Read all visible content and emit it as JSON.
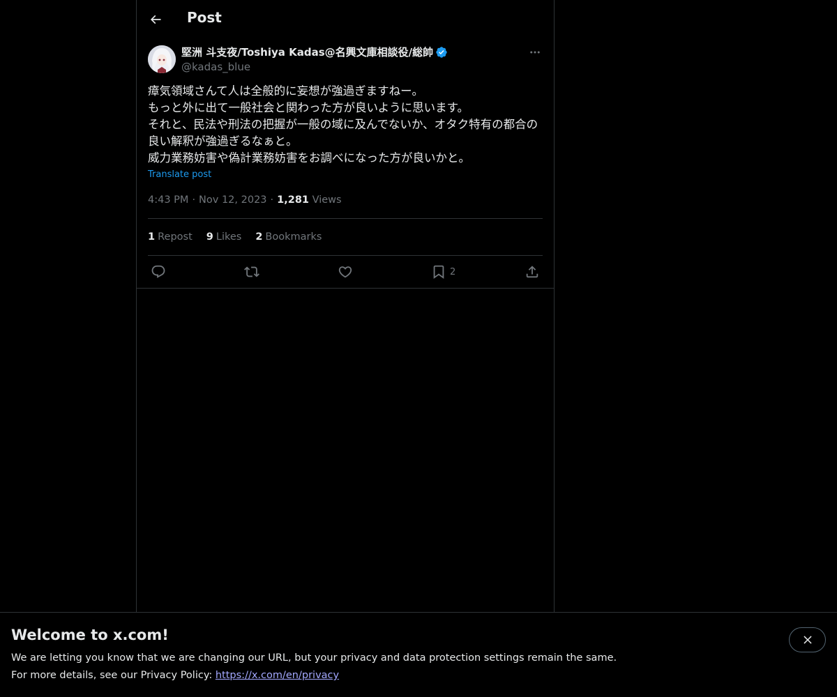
{
  "header": {
    "title": "Post",
    "back_icon": "arrow-left-icon"
  },
  "post": {
    "author": {
      "display_name": "堅洲 斗支夜/Toshiya Kadas@名興文庫相談役/総帥",
      "handle": "@kadas_blue",
      "verified": true,
      "verified_color": "#1d9bf0"
    },
    "text": "瘴気領域さんて人は全般的に妄想が強過ぎますねー。\nもっと外に出て一般社会と関わった方が良いように思います。\nそれと、民法や刑法の把握が一般の域に及んでないか、オタク特有の都合の良い解釈が強過ぎるなぁと。\n威力業務妨害や偽計業務妨害をお調べになった方が良いかと。",
    "translate_label": "Translate post",
    "time": "4:43 PM",
    "date": "Nov 12, 2023",
    "separator": "·",
    "views_count": "1,281",
    "views_label": "Views",
    "stats": {
      "reposts_count": "1",
      "reposts_label": "Repost",
      "likes_count": "9",
      "likes_label": "Likes",
      "bookmarks_count": "2",
      "bookmarks_label": "Bookmarks"
    },
    "actions": {
      "reply_icon": "reply-icon",
      "repost_icon": "repost-icon",
      "like_icon": "heart-icon",
      "bookmark_icon": "bookmark-icon",
      "bookmark_count": "2",
      "share_icon": "share-icon"
    }
  },
  "banner": {
    "title": "Welcome to x.com!",
    "line1": "We are letting you know that we are changing our URL, but your privacy and data protection settings remain the same.",
    "line2_prefix": "For more details, see our Privacy Policy: ",
    "link": "https://x.com/en/privacy",
    "close_icon": "close-icon"
  },
  "colors": {
    "background": "#000000",
    "text": "#e7e9ea",
    "secondary_text": "#71767b",
    "accent": "#1d9bf0",
    "border": "#2f3336"
  }
}
